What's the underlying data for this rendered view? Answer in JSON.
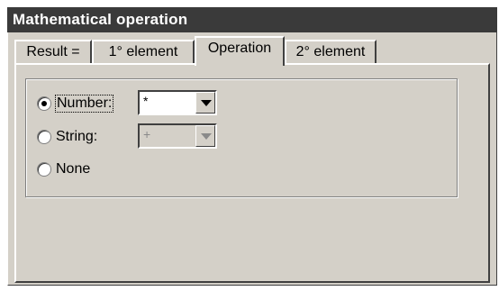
{
  "window": {
    "title": "Mathematical operation"
  },
  "tabs": [
    {
      "label": "Result =",
      "active": false
    },
    {
      "label": "1° element",
      "active": false
    },
    {
      "label": "Operation",
      "active": true
    },
    {
      "label": "2° element",
      "active": false
    }
  ],
  "options": {
    "number": {
      "label": "Number:",
      "checked": true,
      "combo_value": "*",
      "combo_enabled": true
    },
    "string": {
      "label": "String:",
      "checked": false,
      "combo_value": "+",
      "combo_enabled": false
    },
    "none": {
      "label": "None",
      "checked": false
    }
  },
  "icons": {
    "dropdown": "chevron-down-icon"
  }
}
